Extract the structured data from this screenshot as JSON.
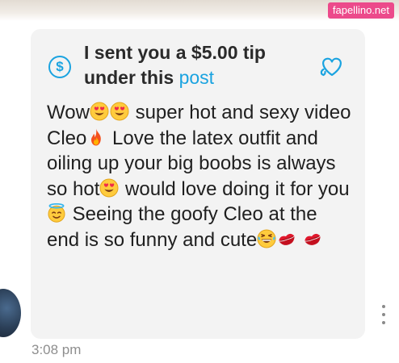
{
  "watermark": "fapellino.net",
  "tip": {
    "line1": "I sent you a $5.00 tip",
    "line2_prefix": "under this ",
    "link": "post",
    "currency_icon": "$"
  },
  "message": {
    "t1": "Wow",
    "t2": " super hot and sexy video Cleo",
    "t3": " Love the latex outfit and oiling up your big boobs is always so hot",
    "t4": " would love doing it for you",
    "t5": " Seeing the goofy Cleo at the end is so funny and cute",
    "emojis": [
      "heart-eyes-emoji",
      "heart-eyes-emoji",
      "fire-emoji",
      "heart-eyes-emoji",
      "halo-emoji",
      "laughing-emoji",
      "kiss-mark-emoji",
      "kiss-mark-emoji"
    ]
  },
  "timestamp": "3:08 pm",
  "colors": {
    "accent": "#1aa3e0",
    "bubble": "#f3f3f3",
    "watermark_bg": "#ec4a8b",
    "timestamp": "#8e8e8e"
  },
  "icons": {
    "tip": "dollar-circle-icon",
    "like": "heart-outline-icon",
    "menu": "more-vertical-icon"
  }
}
